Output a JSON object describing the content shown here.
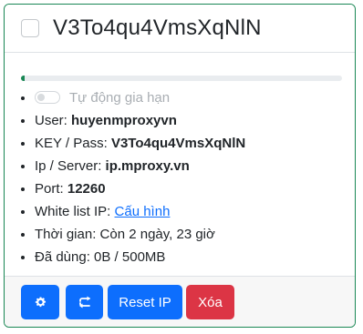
{
  "header": {
    "title": "V3To4qu4VmsXqNlN",
    "select_checked": false
  },
  "usage": {
    "progress_fraction": 0.01
  },
  "info": {
    "auto_renew_label": "Tự động gia hạn",
    "auto_renew_on": false,
    "user_label": "User:",
    "user_value": "huyenmproxyvn",
    "key_label": "KEY / Pass:",
    "key_value": "V3To4qu4VmsXqNlN",
    "server_label": "Ip / Server:",
    "server_value": "ip.mproxy.vn",
    "port_label": "Port:",
    "port_value": "12260",
    "whitelist_label": "White list IP:",
    "whitelist_link": "Cấu hình",
    "time_text": "Thời gian: Còn 2 ngày, 23 giờ",
    "used_text": "Đã dùng: 0B / 500MB"
  },
  "footer": {
    "settings_icon": "gear-icon",
    "rotate_icon": "rotate-arrows-icon",
    "reset_ip_label": "Reset IP",
    "delete_label": "Xóa"
  },
  "colors": {
    "border": "#198754",
    "primary": "#0d6efd",
    "danger": "#dc3545"
  }
}
